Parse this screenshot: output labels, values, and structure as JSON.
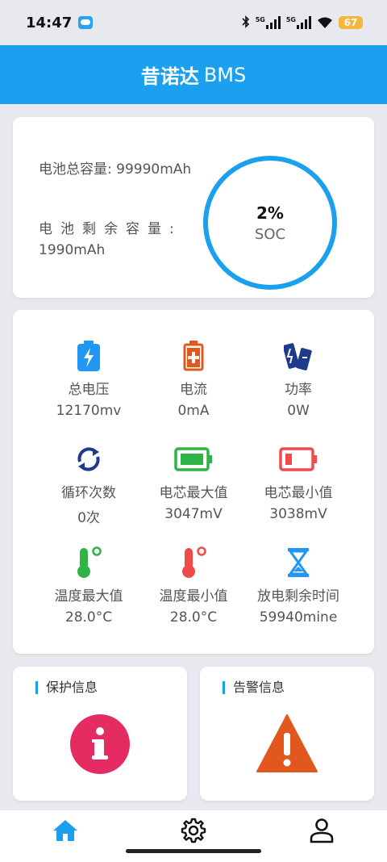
{
  "status_bar": {
    "time": "14:47",
    "signal1": "5G",
    "signal2": "5G",
    "battery": "67"
  },
  "header": {
    "title_cn": "昔诺达",
    "title_en": "BMS"
  },
  "capacity": {
    "total_label": "电池总容量: 99990mAh",
    "remaining_label": "电池剩余容量:",
    "remaining_value": "1990mAh",
    "soc_value": "2%",
    "soc_label": "SOC",
    "soc_fraction": 0.02
  },
  "metrics": [
    {
      "label": "总电压",
      "value": "12170mv",
      "icon": "battery-charging-icon",
      "color": "#2196f3"
    },
    {
      "label": "电流",
      "value": "0mA",
      "icon": "battery-plus-icon",
      "color": "#e2571e"
    },
    {
      "label": "功率",
      "value": "0W",
      "icon": "batteries-icon",
      "color": "#1e3a8a"
    },
    {
      "label": "循环次数",
      "value": "0次",
      "icon": "cycle-icon",
      "color": "#1e3a8a"
    },
    {
      "label": "电芯最大值",
      "value": "3047mV",
      "icon": "battery-full-icon",
      "color": "#2fb344"
    },
    {
      "label": "电芯最小值",
      "value": "3038mV",
      "icon": "battery-low-icon",
      "color": "#ef4b4b"
    },
    {
      "label": "温度最大值",
      "value": "28.0°C",
      "icon": "thermometer-high-icon",
      "color": "#2fb344"
    },
    {
      "label": "温度最小值",
      "value": "28.0°C",
      "icon": "thermometer-low-icon",
      "color": "#ef4b4b"
    },
    {
      "label": "放电剩余时间",
      "value": "59940mine",
      "icon": "hourglass-icon",
      "color": "#2196f3"
    }
  ],
  "protection": {
    "title": "保护信息"
  },
  "warning": {
    "title": "告警信息"
  },
  "colors": {
    "accent": "#1aa0ee",
    "info": "#e42b62",
    "warning": "#e2571e"
  }
}
